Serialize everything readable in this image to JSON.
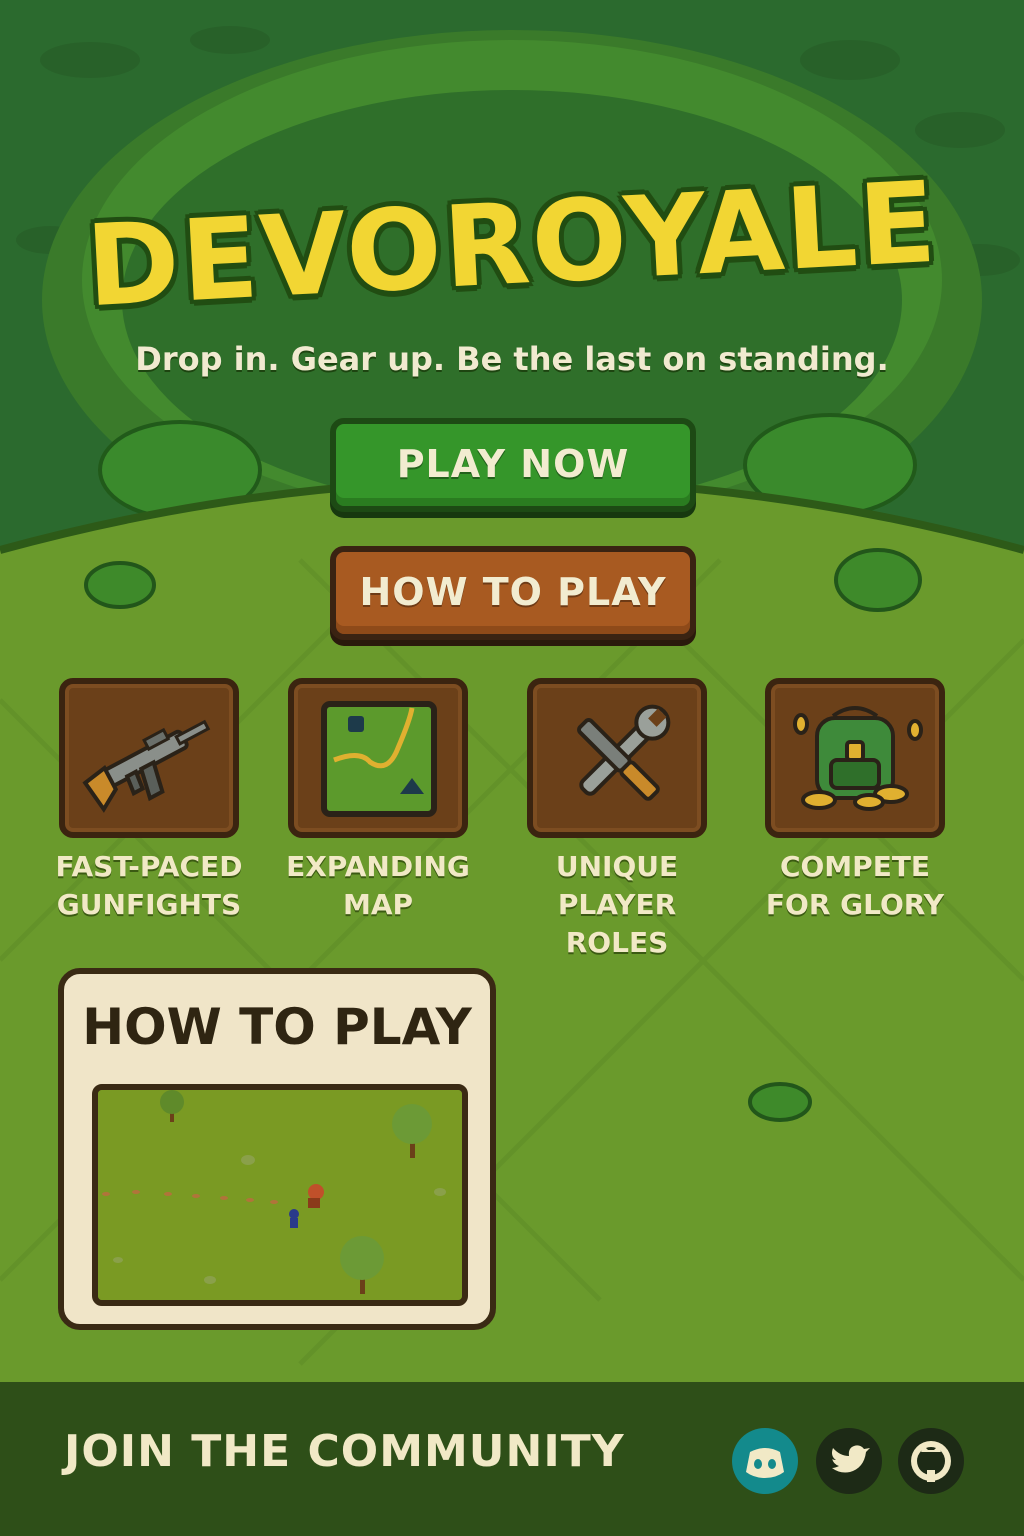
{
  "app": {
    "title": "DEVOROYALE",
    "tagline": "Drop in. Gear up. Be the last on standing."
  },
  "buttons": {
    "play_label": "PLAY NOW",
    "how_label": "HOW TO PLAY"
  },
  "features": [
    {
      "icon": "rifle-icon",
      "label": "FAST-PACED\nGUNFIGHTS"
    },
    {
      "icon": "map-icon",
      "label": "EXPANDING\nMAP"
    },
    {
      "icon": "tools-icon",
      "label": "UNIQUE\nPLAYER ROLES"
    },
    {
      "icon": "backpack-coins-icon",
      "label": "COMPETE\nFOR GLORY"
    }
  ],
  "howto_card": {
    "title": "HOW TO PLAY"
  },
  "footer": {
    "label": "JOIN THE COMMUNITY",
    "socials": [
      "discord-icon",
      "twitter-icon",
      "github-icon"
    ]
  },
  "colors": {
    "title": "#f2d633",
    "play_button": "#35962a",
    "how_button": "#a85a21",
    "grass": "#6a9a2c",
    "forest": "#2c6b2c",
    "footer": "#2e4f18"
  }
}
